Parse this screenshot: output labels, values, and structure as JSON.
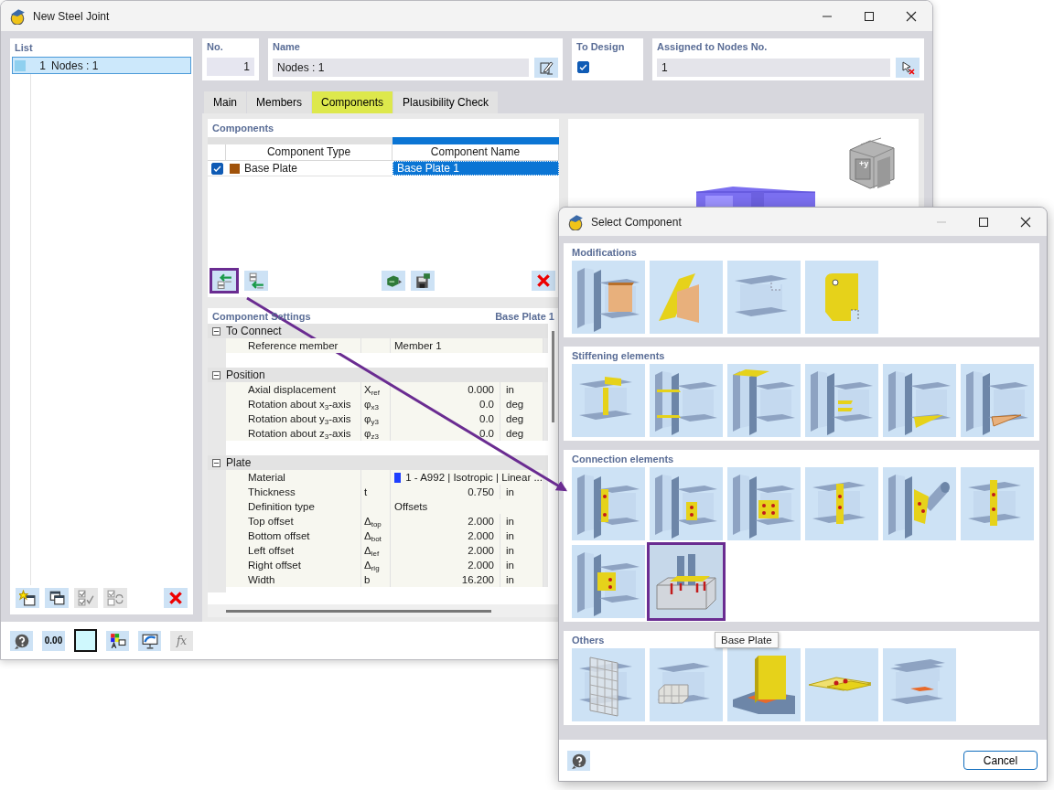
{
  "window": {
    "title": "New Steel Joint"
  },
  "list": {
    "title": "List",
    "items": [
      {
        "number": "1",
        "label": "Nodes : 1",
        "selected": true
      }
    ],
    "toolbar": [
      {
        "kind": "new",
        "disabled": false
      },
      {
        "kind": "copy",
        "disabled": false
      },
      {
        "kind": "check-all",
        "disabled": true
      },
      {
        "kind": "check-toggle",
        "disabled": true
      },
      {
        "kind": "delete",
        "disabled": false
      }
    ]
  },
  "header": {
    "number": {
      "label": "No.",
      "value": "1"
    },
    "name": {
      "label": "Name",
      "value": "Nodes : 1"
    },
    "to_design": {
      "label": "To Design",
      "checked": true
    },
    "assigned_nodes": {
      "label": "Assigned to Nodes No.",
      "value": "1"
    }
  },
  "tabs": [
    {
      "label": "Main",
      "selected": false
    },
    {
      "label": "Members",
      "selected": false
    },
    {
      "label": "Components",
      "selected": true
    },
    {
      "label": "Plausibility Check",
      "selected": false
    }
  ],
  "components": {
    "title": "Components",
    "columns": [
      "Component Type",
      "Component Name"
    ],
    "rows": [
      {
        "checked": true,
        "color": "#a0520a",
        "type": "Base Plate",
        "name": "Base Plate 1",
        "selected": true
      }
    ],
    "toolbar": [
      {
        "kind": "insert-before",
        "highlighted": true
      },
      {
        "kind": "insert-after",
        "highlighted": false
      },
      {
        "kind": "export",
        "highlighted": false
      },
      {
        "kind": "save",
        "highlighted": false
      },
      {
        "kind": "delete",
        "highlighted": false
      }
    ]
  },
  "settings": {
    "title": "Component Settings",
    "component": "Base Plate 1",
    "groups": [
      {
        "label": "To Connect",
        "expanded": true,
        "rows": [
          {
            "label": "Reference member",
            "value": "Member 1"
          }
        ]
      },
      {
        "label": "Position",
        "expanded": true,
        "rows": [
          {
            "label": "Axial displacement",
            "symbol": "X$_{ref}$",
            "value": "0.000",
            "unit": "in"
          },
          {
            "label": "Rotation about x$_{3}$-axis",
            "symbol": "φ$_{x3}$",
            "value": "0.0",
            "unit": "deg"
          },
          {
            "label": "Rotation about y$_{3}$-axis",
            "symbol": "φ$_{y3}$",
            "value": "0.0",
            "unit": "deg"
          },
          {
            "label": "Rotation about z$_{3}$-axis",
            "symbol": "φ$_{z3}$",
            "value": "0.0",
            "unit": "deg"
          }
        ]
      },
      {
        "label": "Plate",
        "expanded": true,
        "rows": [
          {
            "label": "Material",
            "symbol": "",
            "value": "1 - A992 | Isotropic | Linear ...",
            "color": "#1f3fff"
          },
          {
            "label": "Thickness",
            "symbol": "t",
            "value": "0.750",
            "unit": "in"
          },
          {
            "label": "Definition type",
            "value": "Offsets"
          },
          {
            "label": "Top offset",
            "symbol": "Δ$_{top}$",
            "value": "2.000",
            "unit": "in"
          },
          {
            "label": "Bottom offset",
            "symbol": "Δ$_{bot}$",
            "value": "2.000",
            "unit": "in"
          },
          {
            "label": "Left offset",
            "symbol": "Δ$_{lef}$",
            "value": "2.000",
            "unit": "in"
          },
          {
            "label": "Right offset",
            "symbol": "Δ$_{rig}$",
            "value": "2.000",
            "unit": "in"
          },
          {
            "label": "Width",
            "symbol": "b",
            "value": "16.200",
            "unit": "in"
          }
        ]
      }
    ]
  },
  "preview": {
    "cube_label": "+y"
  },
  "main_toolbar": [
    {
      "kind": "help",
      "disabled": false
    },
    {
      "kind": "decimals",
      "label": "0.00",
      "disabled": false
    },
    {
      "kind": "color",
      "disabled": false
    },
    {
      "kind": "legend",
      "disabled": false
    },
    {
      "kind": "display",
      "disabled": false
    },
    {
      "kind": "formula",
      "label": "fx",
      "disabled": true
    }
  ],
  "dialog": {
    "title": "Select Component",
    "minimize_disabled": true,
    "sections": [
      {
        "title": "Modifications",
        "tiles": [
          {
            "kind": "column-beam-web",
            "selected": false
          },
          {
            "kind": "slanted-plates",
            "selected": false
          },
          {
            "kind": "notched-beam",
            "selected": false
          },
          {
            "kind": "cut-plate",
            "selected": false
          }
        ]
      },
      {
        "title": "Stiffening elements",
        "tiles": [
          {
            "kind": "beam-stiffener",
            "selected": false
          },
          {
            "kind": "column-stiffeners",
            "selected": false
          },
          {
            "kind": "column-cap",
            "selected": false
          },
          {
            "kind": "column-fins",
            "selected": false
          },
          {
            "kind": "column-haunch",
            "selected": false
          },
          {
            "kind": "column-haunch-orange",
            "selected": false
          }
        ]
      },
      {
        "title": "Connection elements",
        "tiles": [
          {
            "kind": "end-plate",
            "selected": false
          },
          {
            "kind": "fin-plate",
            "selected": false
          },
          {
            "kind": "angle-cleats",
            "selected": false
          },
          {
            "kind": "splice",
            "selected": false
          },
          {
            "kind": "tube-gusset",
            "selected": false
          },
          {
            "kind": "flange-splice",
            "selected": false
          },
          {
            "kind": "cleat-seat",
            "selected": false
          },
          {
            "kind": "base-plate",
            "selected": true
          }
        ]
      },
      {
        "title": "Others",
        "tiles": [
          {
            "kind": "mesh",
            "selected": false
          },
          {
            "kind": "block",
            "selected": false
          },
          {
            "kind": "weld-plate",
            "selected": false
          },
          {
            "kind": "lap-plates",
            "selected": false
          },
          {
            "kind": "double-beam",
            "selected": false
          }
        ]
      }
    ],
    "tooltip": "Base Plate",
    "buttons": [
      {
        "label": "Cancel"
      }
    ]
  }
}
